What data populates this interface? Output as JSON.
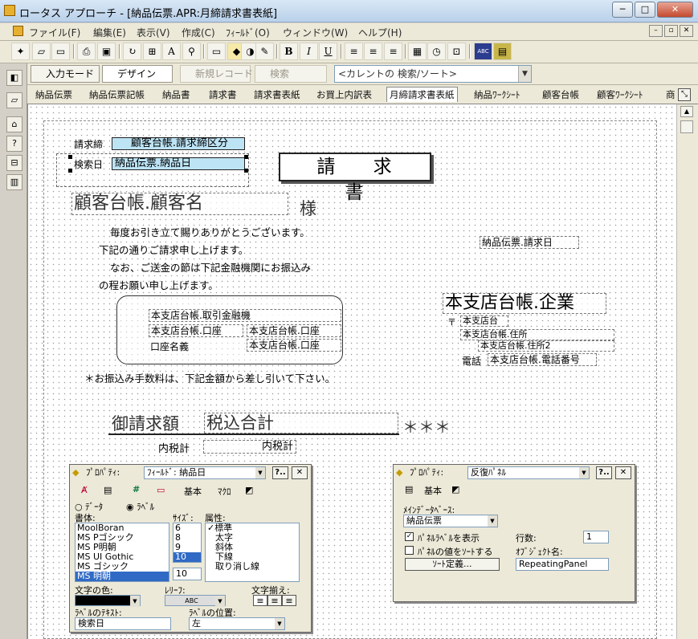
{
  "window": {
    "title": "ロータス アプローチ - [納品伝票.APR:月締請求書表紙]",
    "minimize": "─",
    "maximize": "□",
    "close": "✕"
  },
  "menu": {
    "items": [
      "ファイル(F)",
      "編集(E)",
      "表示(V)",
      "作成(C)",
      "ﾌｨｰﾙﾄﾞ(O)",
      "ウィンドウ(W)",
      "ヘルプ(H)"
    ],
    "mdi_min": "–",
    "mdi_restore": "▫",
    "mdi_close": "✕"
  },
  "toolbar": {
    "bold": "B",
    "italic": "I",
    "underline": "U",
    "abc": "ABC"
  },
  "modebar": {
    "input_mode": "入力モード",
    "design": "デザイン",
    "new_record": "新規レコード",
    "search": "検索",
    "current_search": "<カレントの 検索/ソート>"
  },
  "tabs": [
    "納品伝票",
    "納品伝票記帳",
    "納品書",
    "請求書",
    "請求書表紙",
    "お買上内訳表",
    "月締請求書表紙",
    "納品ﾜｰｸｼｰﾄ",
    "顧客台帳",
    "顧客ﾜｰｸｼｰﾄ",
    "商"
  ],
  "active_tab": "月締請求書表紙",
  "form": {
    "label_billing_cutoff": "請求締",
    "field_billing_cutoff": "顧客台帳.請求締区分",
    "label_search_date": "検索日",
    "field_search_date": "納品伝票.納品日",
    "invoice_title": "請 求 書",
    "customer_name": "顧客台帳.顧客名",
    "honorific": "様",
    "greeting": [
      "毎度お引き立て賜りありがとうございます。",
      "下記の通りご請求申し上げます。",
      "なお、ご送金の節は下記金融機関にお振込み",
      "の程お願い申し上げます。"
    ],
    "billing_date": "納品伝票.請求日",
    "company": "本支店台帳.企業",
    "postal_mark": "〒",
    "branch": "本支店台",
    "address1": "本支店台帳.住所",
    "address2": "本支店台帳.住所2",
    "phone_label": "電話",
    "phone_field": "本支店台帳.電話番号",
    "bank_name": "本支店台帳.取引金融機",
    "bank_account_type": "本支店台帳.口座",
    "bank_account_no": "本支店台帳.口座",
    "account_name_label": "口座名義",
    "account_name_field": "本支店台帳.口座",
    "fee_note": "＊お振込み手数料は、下記金額から差し引いて下さい。",
    "amount_label": "御請求額",
    "amount_field": "税込合計",
    "amount_stars": "＊＊＊",
    "tax_label": "内税計",
    "tax_field": "内税計"
  },
  "prop_panel_1": {
    "title": "ﾌﾟﾛﾊﾟﾃｨ:",
    "target": "ﾌｨｰﾙﾄﾞ: 納品日",
    "help": "?..",
    "close": "✕",
    "tabs": [
      "基本",
      "ﾏｸﾛ"
    ],
    "radio_data": "ﾃﾞｰﾀ",
    "radio_label": "ﾗﾍﾞﾙ",
    "font_header": "書体:",
    "size_header": "ｻｲｽﾞ:",
    "attr_header": "属性:",
    "fonts": [
      "MoolBoran",
      "MS Pゴシック",
      "MS P明朝",
      "MS UI Gothic",
      "MS ゴシック",
      "MS 明朝"
    ],
    "selected_font": "MS 明朝",
    "sizes": [
      "6",
      "8",
      "9",
      "10"
    ],
    "selected_size": "10",
    "size_value": "10",
    "attributes": [
      "標準",
      "太字",
      "斜体",
      "下線",
      "取り消し線"
    ],
    "checked_attr_mark": "✓",
    "text_color_label": "文字の色:",
    "relief_label": "ﾚﾘｰﾌ:",
    "relief_value": "ABC",
    "align_label": "文字揃え:",
    "label_text_label": "ﾗﾍﾞﾙのﾃｷｽﾄ:",
    "label_text_value": "検索日",
    "label_pos_label": "ﾗﾍﾞﾙの位置:",
    "label_pos_value": "左"
  },
  "prop_panel_2": {
    "title": "ﾌﾟﾛﾊﾟﾃｨ:",
    "target": "反復ﾊﾟﾈﾙ",
    "help": "?..",
    "close": "✕",
    "tabs": [
      "基本"
    ],
    "main_db_label": "ﾒｲﾝﾃﾞｰﾀﾍﾞｰｽ:",
    "main_db_value": "納品伝票",
    "show_label": "ﾊﾟﾈﾙﾗﾍﾞﾙを表示",
    "show_label_checked": "✓",
    "sort_values": "ﾊﾟﾈﾙの値をｿｰﾄする",
    "rows_label": "行数:",
    "rows_value": "1",
    "object_name_label": "ｵﾌﾞｼﾞｪｸﾄ名:",
    "object_name_value": "RepeatingPanel",
    "sort_def_button": "ｿｰﾄ定義..."
  },
  "colors": {
    "field_bg": "#bde4f5",
    "selection": "#316ac5",
    "canvas": "#ffffff"
  }
}
